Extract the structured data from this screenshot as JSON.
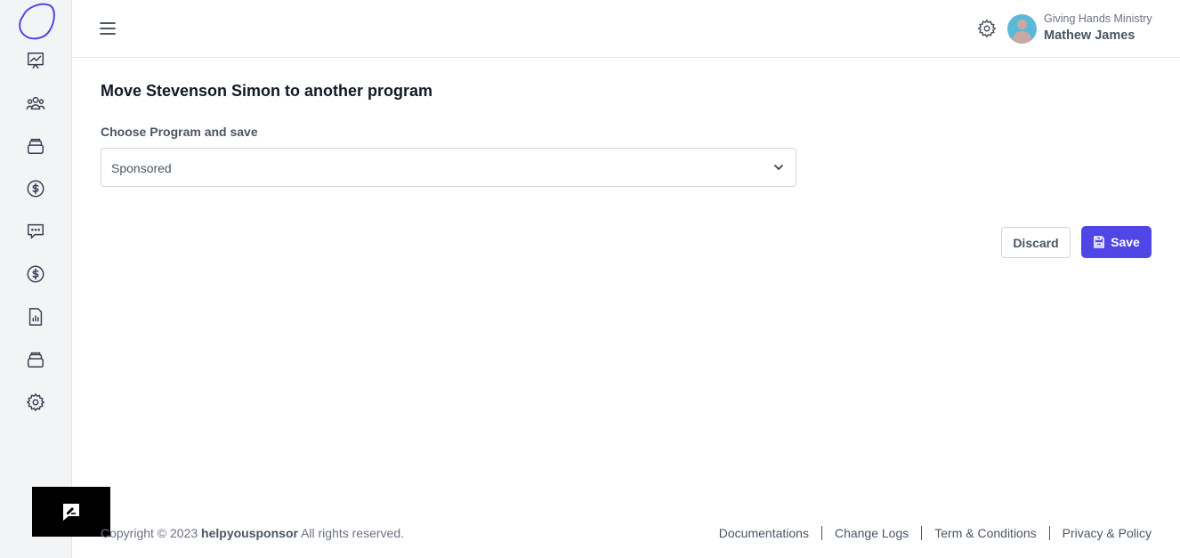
{
  "sidebar": {
    "items": [
      {
        "icon": "trending-chart-icon"
      },
      {
        "icon": "users-group-icon"
      },
      {
        "icon": "layers-icon"
      },
      {
        "icon": "dollar-icon"
      },
      {
        "icon": "chat-bubble-icon"
      },
      {
        "icon": "dollar-icon"
      },
      {
        "icon": "report-document-icon"
      },
      {
        "icon": "layers-icon"
      },
      {
        "icon": "settings-gear-icon"
      }
    ]
  },
  "header": {
    "org_name": "Giving Hands Ministry",
    "user_name": "Mathew James"
  },
  "main": {
    "title": "Move Stevenson Simon to another program",
    "field_label": "Choose Program and save",
    "select_value": "Sponsored",
    "discard_label": "Discard",
    "save_label": "Save",
    "accent_color": "#4f46e5"
  },
  "footer": {
    "copyright_prefix": "Copyright © 2023 ",
    "brand": "helpyousponsor",
    "copyright_suffix": " All rights reserved.",
    "links": [
      "Documentations",
      "Change Logs",
      "Term & Conditions",
      "Privacy & Policy"
    ]
  }
}
